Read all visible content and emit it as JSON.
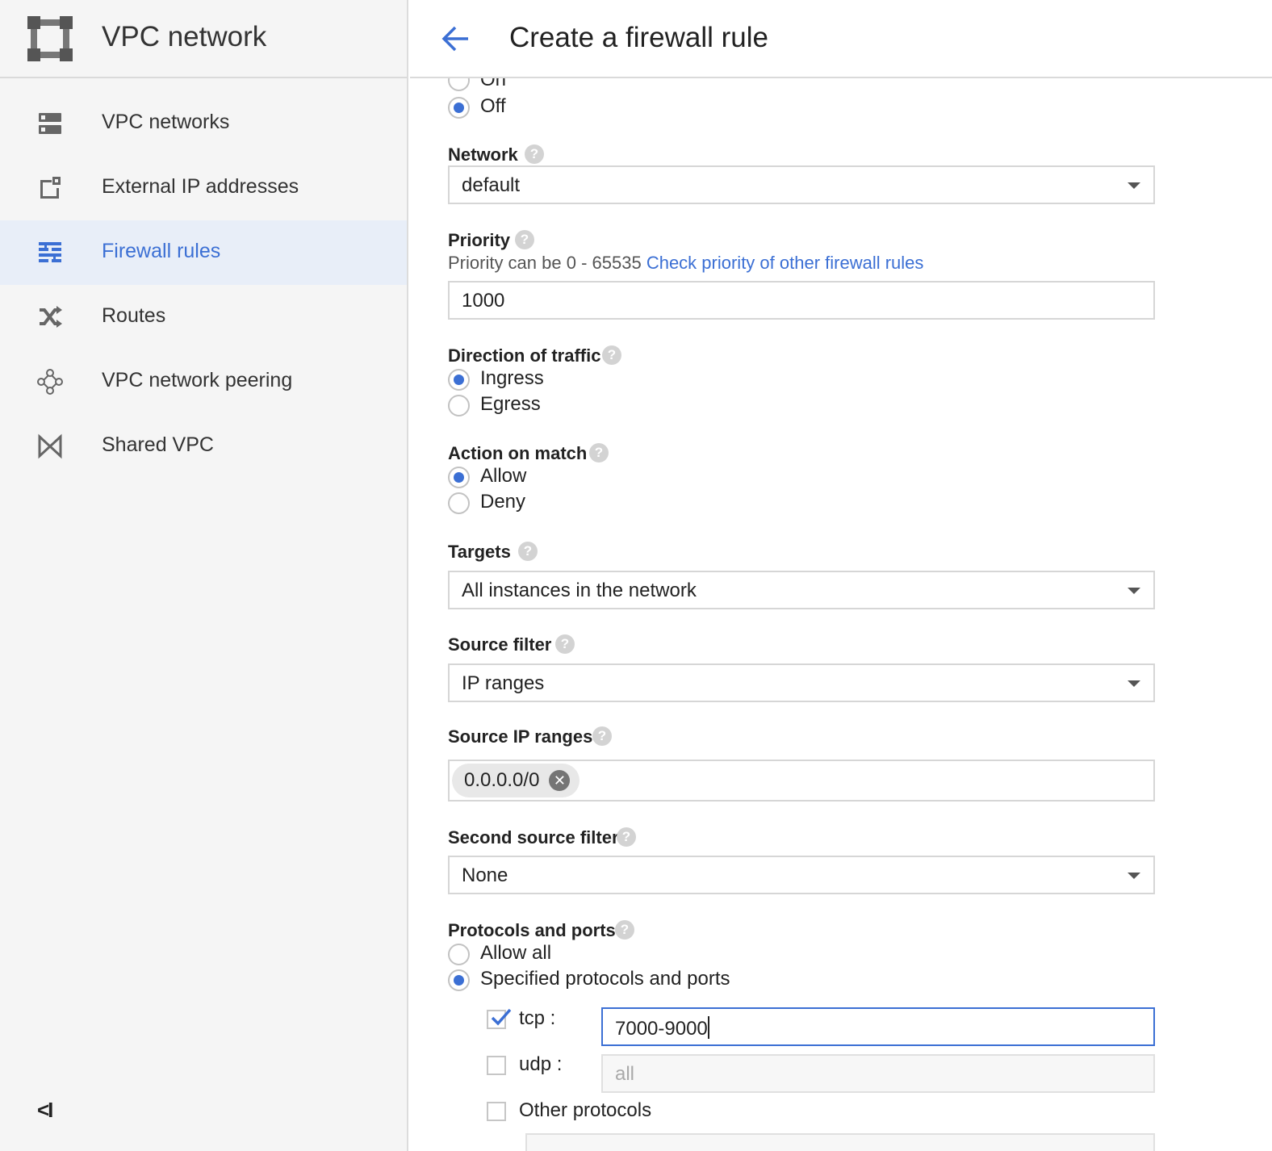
{
  "app": {
    "title": "VPC network",
    "brand_icon": "vpc-network-icon"
  },
  "sidebar": {
    "items": [
      {
        "label": "VPC networks",
        "icon": "vpc-networks-icon",
        "active": false
      },
      {
        "label": "External IP addresses",
        "icon": "external-ip-icon",
        "active": false
      },
      {
        "label": "Firewall rules",
        "icon": "firewall-icon",
        "active": true
      },
      {
        "label": "Routes",
        "icon": "routes-icon",
        "active": false
      },
      {
        "label": "VPC network peering",
        "icon": "peering-icon",
        "active": false
      },
      {
        "label": "Shared VPC",
        "icon": "shared-vpc-icon",
        "active": false
      }
    ],
    "collapse_label": "<I"
  },
  "header": {
    "title": "Create a firewall rule",
    "back_icon": "back-arrow-icon"
  },
  "form": {
    "logs": {
      "options": [
        "On",
        "Off"
      ],
      "selected": "Off"
    },
    "network": {
      "label": "Network",
      "value": "default"
    },
    "priority": {
      "label": "Priority",
      "hint": "Priority can be 0 - 65535",
      "link": "Check priority of other firewall rules",
      "value": "1000"
    },
    "direction": {
      "label": "Direction of traffic",
      "options": [
        "Ingress",
        "Egress"
      ],
      "selected": "Ingress"
    },
    "action": {
      "label": "Action on match",
      "options": [
        "Allow",
        "Deny"
      ],
      "selected": "Allow"
    },
    "targets": {
      "label": "Targets",
      "value": "All instances in the network"
    },
    "source_filter": {
      "label": "Source filter",
      "value": "IP ranges"
    },
    "source_ip_ranges": {
      "label": "Source IP ranges",
      "chips": [
        "0.0.0.0/0"
      ]
    },
    "second_source_filter": {
      "label": "Second source filter",
      "value": "None"
    },
    "protocols": {
      "label": "Protocols and ports",
      "options": [
        "Allow all",
        "Specified protocols and ports"
      ],
      "selected": "Specified protocols and ports",
      "tcp": {
        "label": "tcp :",
        "checked": true,
        "value": "7000-9000"
      },
      "udp": {
        "label": "udp :",
        "checked": false,
        "placeholder": "all"
      },
      "other": {
        "label": "Other protocols",
        "checked": false
      }
    }
  },
  "colors": {
    "accent": "#3b6fd4",
    "sidebar_bg": "#f5f5f5",
    "active_bg": "#e8eef8"
  }
}
